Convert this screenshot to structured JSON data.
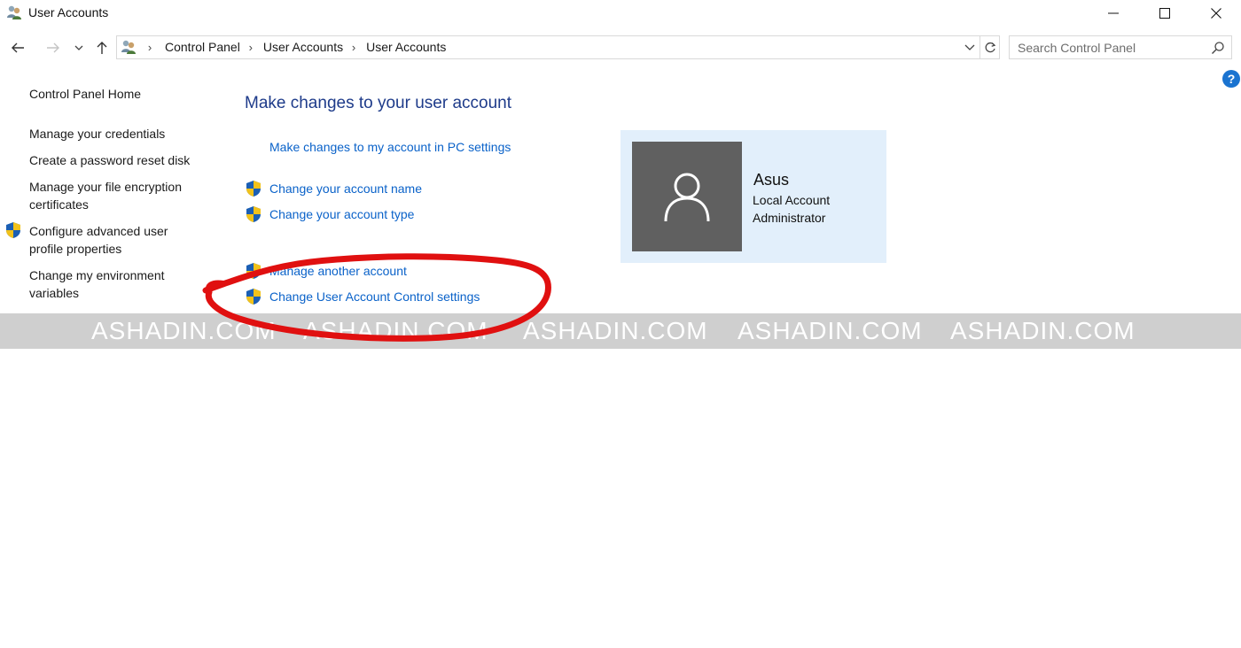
{
  "window": {
    "title": "User Accounts"
  },
  "navigation": {
    "breadcrumbs": [
      "Control Panel",
      "User Accounts",
      "User Accounts"
    ],
    "search_placeholder": "Search Control Panel"
  },
  "help": {
    "label": "?"
  },
  "left_nav": {
    "home": "Control Panel Home",
    "items": [
      "Manage your credentials",
      "Create a password reset disk",
      "Manage your file encryption certificates",
      "Configure advanced user profile properties",
      "Change my environment variables"
    ],
    "items_lines": [
      [
        "Manage your credentials"
      ],
      [
        "Create a password reset disk"
      ],
      [
        "Manage your file encryption",
        "certificates"
      ],
      [
        "Configure advanced user",
        "profile properties"
      ],
      [
        "Change my environment",
        "variables"
      ]
    ]
  },
  "main": {
    "heading": "Make changes to your user account",
    "pc_settings_link": "Make changes to my account in PC settings",
    "tasks": [
      "Change your account name",
      "Change your account type",
      "Manage another account",
      "Change User Account Control settings"
    ]
  },
  "account": {
    "name": "Asus",
    "type": "Local Account",
    "role": "Administrator"
  },
  "watermark": {
    "text": "ASHADIN.COM",
    "repeats": 5
  },
  "colors": {
    "link": "#0a62c9",
    "heading": "#1e3b8a",
    "tile_bg": "#e2effb",
    "avatar_bg": "#606060",
    "annotation_red": "#e01010"
  },
  "icons": {
    "app": "user-accounts-icon",
    "uac": "uac-shield-icon",
    "avatar": "user-silhouette-icon"
  }
}
